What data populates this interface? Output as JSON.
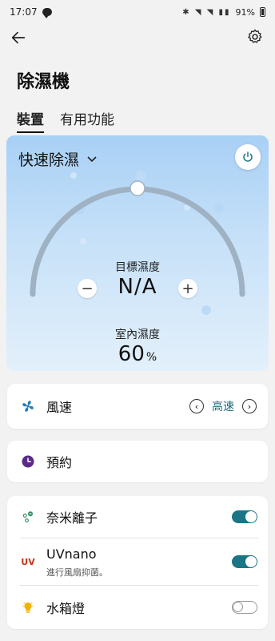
{
  "status_bar": {
    "time": "17:07",
    "battery": "91%"
  },
  "page": {
    "title": "除濕機"
  },
  "tabs": [
    {
      "label": "裝置",
      "active": true
    },
    {
      "label": "有用功能",
      "active": false
    }
  ],
  "hero": {
    "mode": "快速除濕",
    "target_label": "目標濕度",
    "target_value": "N/A",
    "room_label": "室內濕度",
    "room_value": "60",
    "room_unit": "%",
    "minus": "−",
    "plus": "+"
  },
  "fan": {
    "label": "風速",
    "speed": "高速",
    "prev": "‹",
    "next": "›"
  },
  "schedule": {
    "label": "預約"
  },
  "features": [
    {
      "label": "奈米離子",
      "sub": "",
      "on": true,
      "icon": "ion-icon"
    },
    {
      "label": "UVnano",
      "sub": "進行風扇抑菌。",
      "on": true,
      "icon": "uv-icon",
      "icon_text": "UV"
    },
    {
      "label": "水箱燈",
      "sub": "",
      "on": false,
      "icon": "lightbulb-icon"
    }
  ],
  "colors": {
    "accent": "#1b7587",
    "uv": "#c63519",
    "schedule": "#5b2a86",
    "fan": "#2a7fb8",
    "bulb": "#f0b400"
  }
}
